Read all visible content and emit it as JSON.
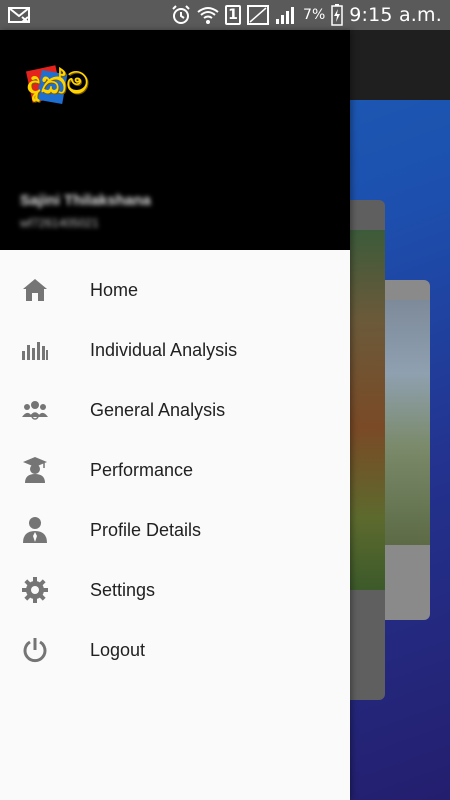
{
  "status_bar": {
    "time": "9:15 a.m.",
    "battery_percent": "7%",
    "sim_slot": "1"
  },
  "drawer": {
    "logo_text": "දැක්ම",
    "user_name": "Sajini Thilakshana",
    "user_subtitle": "wf7261405021",
    "menu": [
      {
        "label": "Home",
        "icon": "home-icon"
      },
      {
        "label": "Individual Analysis",
        "icon": "bar-chart-icon"
      },
      {
        "label": "General Analysis",
        "icon": "group-icon"
      },
      {
        "label": "Performance",
        "icon": "graduate-icon"
      },
      {
        "label": "Profile Details",
        "icon": "person-icon"
      },
      {
        "label": "Settings",
        "icon": "gear-icon"
      },
      {
        "label": "Logout",
        "icon": "power-icon"
      }
    ]
  },
  "colors": {
    "drawer_bg": "#fafafa",
    "header_bg": "#000000",
    "icon": "#757575",
    "label": "#212121",
    "logo_yellow": "#ffd400",
    "logo_red": "#e3231c",
    "logo_blue": "#1e6fd0"
  }
}
